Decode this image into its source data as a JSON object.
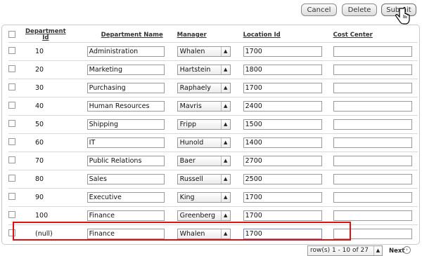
{
  "toolbar": {
    "cancel": "Cancel",
    "delete": "Delete",
    "submit": "Submit"
  },
  "headers": {
    "dept_id_line1": "Department",
    "dept_id_line2": "Id",
    "dept_name": "Department Name",
    "manager": "Manager",
    "location": "Location Id",
    "cost_center": "Cost Center"
  },
  "rows": [
    {
      "id": "10",
      "name": "Administration",
      "manager": "Whalen",
      "location": "1700",
      "cost": ""
    },
    {
      "id": "20",
      "name": "Marketing",
      "manager": "Hartstein",
      "location": "1800",
      "cost": ""
    },
    {
      "id": "30",
      "name": "Purchasing",
      "manager": "Raphaely",
      "location": "1700",
      "cost": ""
    },
    {
      "id": "40",
      "name": "Human Resources",
      "manager": "Mavris",
      "location": "2400",
      "cost": ""
    },
    {
      "id": "50",
      "name": "Shipping",
      "manager": "Fripp",
      "location": "1500",
      "cost": ""
    },
    {
      "id": "60",
      "name": "IT",
      "manager": "Hunold",
      "location": "1400",
      "cost": ""
    },
    {
      "id": "70",
      "name": "Public Relations",
      "manager": "Baer",
      "location": "2700",
      "cost": ""
    },
    {
      "id": "80",
      "name": "Sales",
      "manager": "Russell",
      "location": "2500",
      "cost": ""
    },
    {
      "id": "90",
      "name": "Executive",
      "manager": "King",
      "location": "1700",
      "cost": ""
    },
    {
      "id": "100",
      "name": "Finance",
      "manager": "Greenberg",
      "location": "1700",
      "cost": ""
    },
    {
      "id": "(null)",
      "name": "Finance",
      "manager": "Whalen",
      "location": "1700",
      "cost": ""
    }
  ],
  "pagination": {
    "range": "row(s) 1 - 10 of 27",
    "next": "Next"
  },
  "icons": {
    "select_arrow": "up-down-arrows-icon",
    "next": "chevron-right-circle-icon",
    "cursor": "hand-pointer-icon"
  },
  "colors": {
    "highlight": "#e01010"
  }
}
